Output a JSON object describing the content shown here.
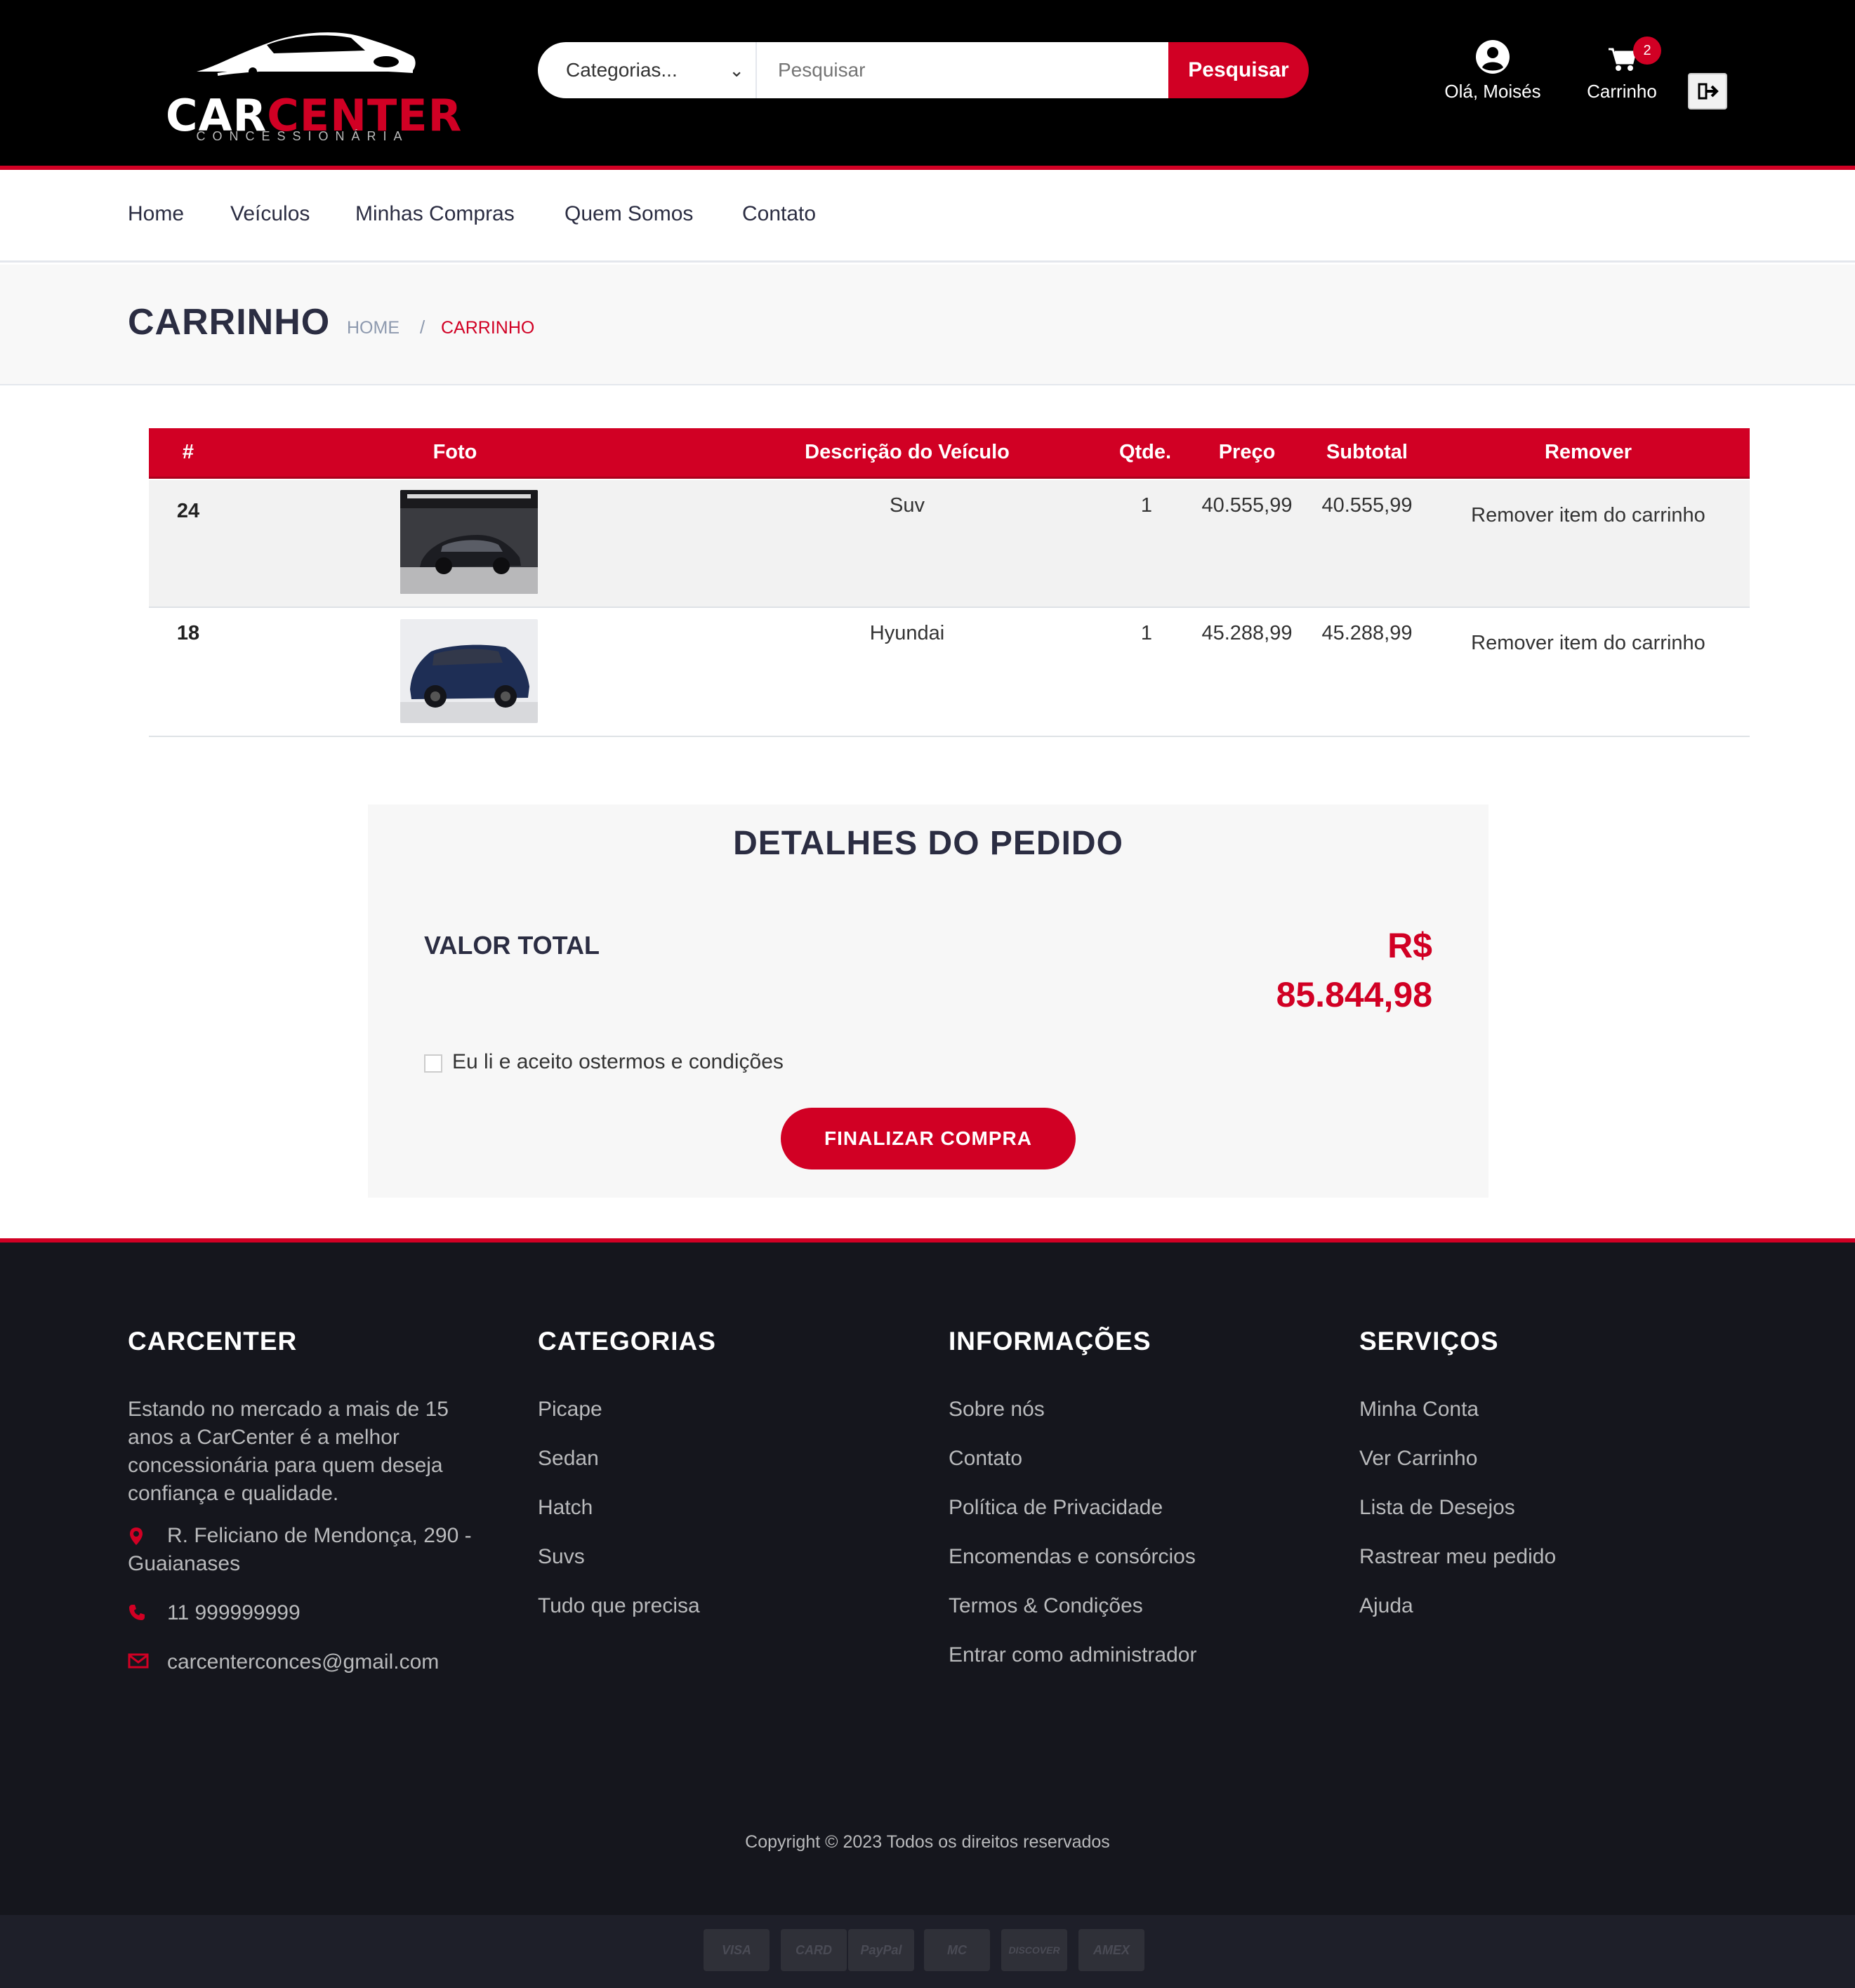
{
  "header": {
    "logo": {
      "brand_a": "CAR",
      "brand_b": "CENTER",
      "tagline": "CONCESSIONÁRIA"
    },
    "search": {
      "category_label": "Categorias...",
      "placeholder": "Pesquisar",
      "button_label": "Pesquisar"
    },
    "account_label": "Olá, Moisés",
    "cart_label": "Carrinho",
    "cart_count": "2"
  },
  "nav": {
    "items": [
      "Home",
      "Veículos",
      "Minhas Compras",
      "Quem Somos",
      "Contato"
    ]
  },
  "breadcrumb": {
    "title": "CARRINHO",
    "home": "HOME",
    "separator": "/",
    "current": "CARRINHO"
  },
  "cart_table": {
    "headers": [
      "#",
      "Foto",
      "Descrição do Veículo",
      "Qtde.",
      "Preço",
      "Subtotal",
      "Remover"
    ],
    "rows": [
      {
        "id": "24",
        "description": "Suv",
        "qty": "1",
        "price": "40.555,99",
        "subtotal": "40.555,99",
        "remove": "Remover item do carrinho"
      },
      {
        "id": "18",
        "description": "Hyundai",
        "qty": "1",
        "price": "45.288,99",
        "subtotal": "45.288,99",
        "remove": "Remover item do carrinho"
      }
    ]
  },
  "order": {
    "title": "DETALHES DO PEDIDO",
    "total_label": "VALOR TOTAL",
    "total_currency": "R$",
    "total_value": "85.844,98",
    "terms": "Eu li e aceito ostermos e condições",
    "finish_button": "FINALIZAR COMPRA"
  },
  "footer": {
    "col1": {
      "title": "CARCENTER",
      "about": "Estando no mercado a mais de 15 anos a CarCenter é a melhor concessionária para quem deseja confiança e qualidade.",
      "address": "R. Feliciano de Mendonça, 290 - Guaianases",
      "phone": "11 999999999",
      "email": "carcenterconces@gmail.com"
    },
    "col2": {
      "title": "CATEGORIAS",
      "links": [
        "Picape",
        "Sedan",
        "Hatch",
        "Suvs",
        "Tudo que precisa"
      ]
    },
    "col3": {
      "title": "INFORMAÇÕES",
      "links": [
        "Sobre nós",
        "Contato",
        "Política de Privacidade",
        "Encomendas e consórcios",
        "Termos & Condições",
        "Entrar como administrador"
      ]
    },
    "col4": {
      "title": "SERVIÇOS",
      "links": [
        "Minha Conta",
        "Ver Carrinho",
        "Lista de Desejos",
        "Rastrear meu pedido",
        "Ajuda"
      ]
    },
    "copyright": "Copyright © 2023 Todos os direitos reservados",
    "payments": [
      "VISA",
      "CARD",
      "PayPal",
      "MC",
      "DISCOVER",
      "AMEX"
    ]
  },
  "colors": {
    "accent": "#d10024",
    "dark": "#15161d",
    "heading": "#2b2d42"
  }
}
